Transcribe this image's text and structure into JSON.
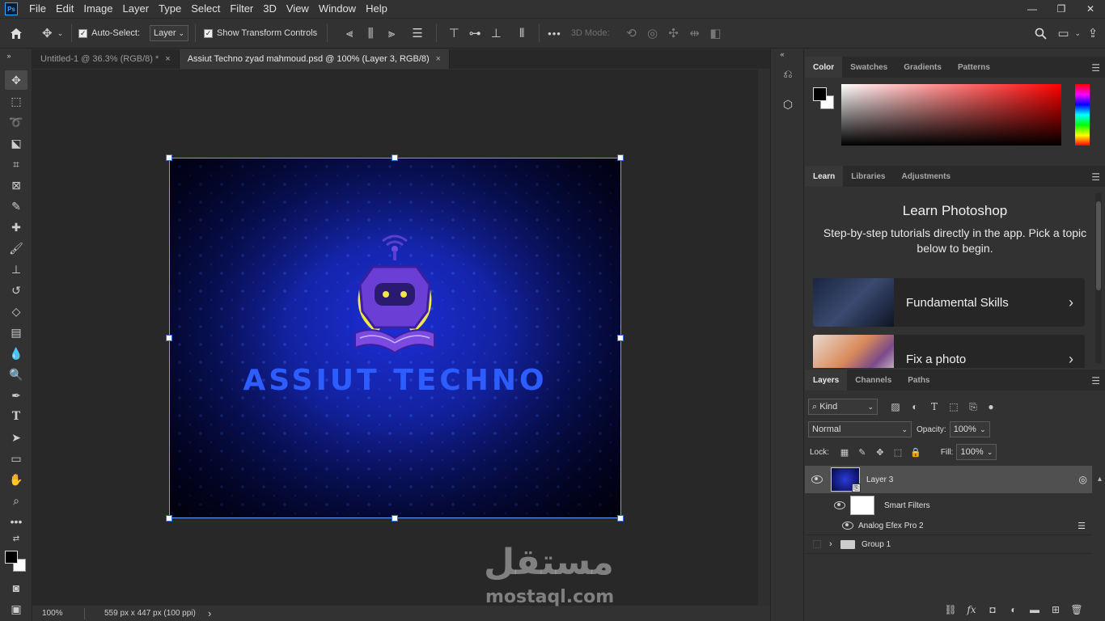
{
  "menu": [
    "File",
    "Edit",
    "Image",
    "Layer",
    "Type",
    "Select",
    "Filter",
    "3D",
    "View",
    "Window",
    "Help"
  ],
  "app_icon": "Ps",
  "options": {
    "auto_select_label": "Auto-Select:",
    "auto_select_value": "Layer",
    "show_transform_label": "Show Transform Controls",
    "mode_3d_label": "3D Mode:",
    "more_label": "•••"
  },
  "tabs": [
    {
      "label": "Untitled-1 @ 36.3% (RGB/8) *",
      "close": "×"
    },
    {
      "label": "Assiut Techno zyad mahmoud.psd @ 100% (Layer 3, RGB/8)",
      "close": "×"
    }
  ],
  "canvas": {
    "brand_text": "ASSIUT TECHNO",
    "watermark_ar": "مستقل",
    "watermark_en": "mostaql.com"
  },
  "status": {
    "zoom": "100%",
    "info": "559 px x 447 px (100 ppi)",
    "arrow": "›"
  },
  "color_panel": {
    "tabs": [
      "Color",
      "Swatches",
      "Gradients",
      "Patterns"
    ],
    "foreground": "#000000",
    "background": "#ffffff",
    "hue_color": "#ff0000"
  },
  "learn_panel": {
    "tabs": [
      "Learn",
      "Libraries",
      "Adjustments"
    ],
    "title": "Learn Photoshop",
    "subtitle": "Step-by-step tutorials directly in the app. Pick a topic below to begin.",
    "cards": [
      {
        "label": "Fundamental Skills",
        "chev": "›"
      },
      {
        "label": "Fix a photo",
        "chev": "›"
      }
    ]
  },
  "layers_panel": {
    "tabs": [
      "Layers",
      "Channels",
      "Paths"
    ],
    "filter_kind": "Kind",
    "blend_mode": "Normal",
    "opacity_label": "Opacity:",
    "opacity_value": "100%",
    "lock_label": "Lock:",
    "fill_label": "Fill:",
    "fill_value": "100%",
    "layers": {
      "layer3": "Layer 3",
      "smart_filters": "Smart Filters",
      "filter": "Analog Efex Pro 2",
      "group1": "Group 1"
    },
    "fx_label": "fx"
  },
  "accent": "#31a8ff"
}
